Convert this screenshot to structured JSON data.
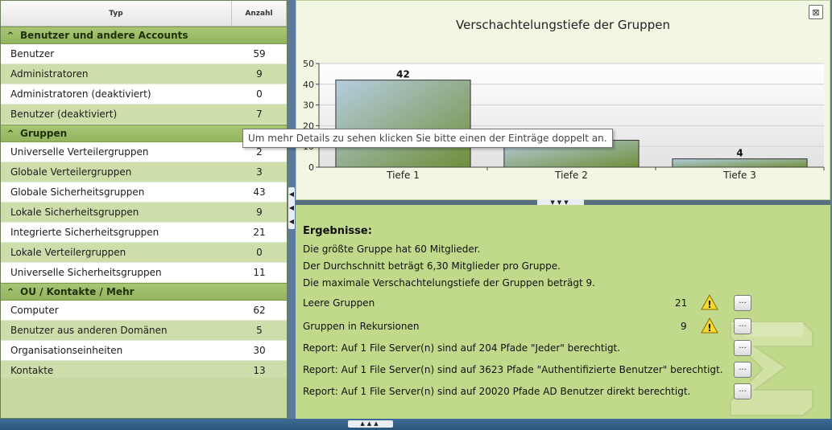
{
  "table": {
    "col_typ": "Typ",
    "col_anzahl": "Anzahl",
    "groups": [
      {
        "title": "Benutzer und andere Accounts",
        "rows": [
          {
            "name": "Benutzer",
            "count": "59"
          },
          {
            "name": "Administratoren",
            "count": "9"
          },
          {
            "name": "Administratoren (deaktiviert)",
            "count": "0"
          },
          {
            "name": "Benutzer (deaktiviert)",
            "count": "7"
          }
        ]
      },
      {
        "title": "Gruppen",
        "rows": [
          {
            "name": "Universelle Verteilergruppen",
            "count": "2"
          },
          {
            "name": "Globale Verteilergruppen",
            "count": "3"
          },
          {
            "name": "Globale Sicherheitsgruppen",
            "count": "43"
          },
          {
            "name": "Lokale Sicherheitsgruppen",
            "count": "9"
          },
          {
            "name": "Integrierte Sicherheitsgruppen",
            "count": "21"
          },
          {
            "name": "Lokale Verteilergruppen",
            "count": "0"
          },
          {
            "name": "Universelle Sicherheitsgruppen",
            "count": "11"
          }
        ]
      },
      {
        "title": "OU / Kontakte / Mehr",
        "rows": [
          {
            "name": "Computer",
            "count": "62"
          },
          {
            "name": "Benutzer aus anderen Domänen",
            "count": "5"
          },
          {
            "name": "Organisationseinheiten",
            "count": "30"
          },
          {
            "name": "Kontakte",
            "count": "13"
          }
        ]
      }
    ]
  },
  "tooltip": "Um mehr Details zu sehen klicken Sie bitte einen der Einträge doppelt an.",
  "chart_data": {
    "type": "bar",
    "title": "Verschachtelungstiefe der Gruppen",
    "categories": [
      "Tiefe 1",
      "Tiefe 2",
      "Tiefe 3"
    ],
    "values": [
      42,
      13,
      4
    ],
    "ylim": [
      0,
      50
    ],
    "yticks": [
      "0",
      "10",
      "20",
      "30",
      "40",
      "50"
    ],
    "xlabel": "",
    "ylabel": "",
    "grid": true,
    "bar_color_start": "#b5cde0",
    "bar_color_end": "#6f8f3a"
  },
  "results": {
    "title": "Ergebnisse:",
    "line1": "Die größte Gruppe hat 60 Mitglieder.",
    "line2": "Der Durchschnitt beträgt 6,30 Mitglieder pro Gruppe.",
    "line3": "Die maximale Verschachtelungstiefe der Gruppen beträgt 9.",
    "items": [
      {
        "label": "Leere Gruppen",
        "count": "21",
        "warning": true
      },
      {
        "label": "Gruppen in Rekursionen",
        "count": "9",
        "warning": true
      },
      {
        "label": "Report: Auf 1 File Server(n) sind auf 204 Pfade \"Jeder\" berechtigt.",
        "count": "",
        "warning": false
      },
      {
        "label": "Report: Auf 1 File Server(n) sind auf 3623 Pfade \"Authentifizierte Benutzer\" berechtigt.",
        "count": "",
        "warning": false
      },
      {
        "label": "Report: Auf 1 File Server(n) sind auf 20020 Pfade AD Benutzer direkt berechtigt.",
        "count": "",
        "warning": false
      }
    ],
    "details_label": "..."
  },
  "icons": {
    "expand": "expand-icon",
    "warning": "warning-icon",
    "sigma": "sigma-icon"
  },
  "colors": {
    "group_header": "#9fbe69",
    "row_alt": "#cddeaa",
    "results_bg": "#c1d98a",
    "chart_bg": "#f2f7e4",
    "frame": "#5b7a9c"
  }
}
